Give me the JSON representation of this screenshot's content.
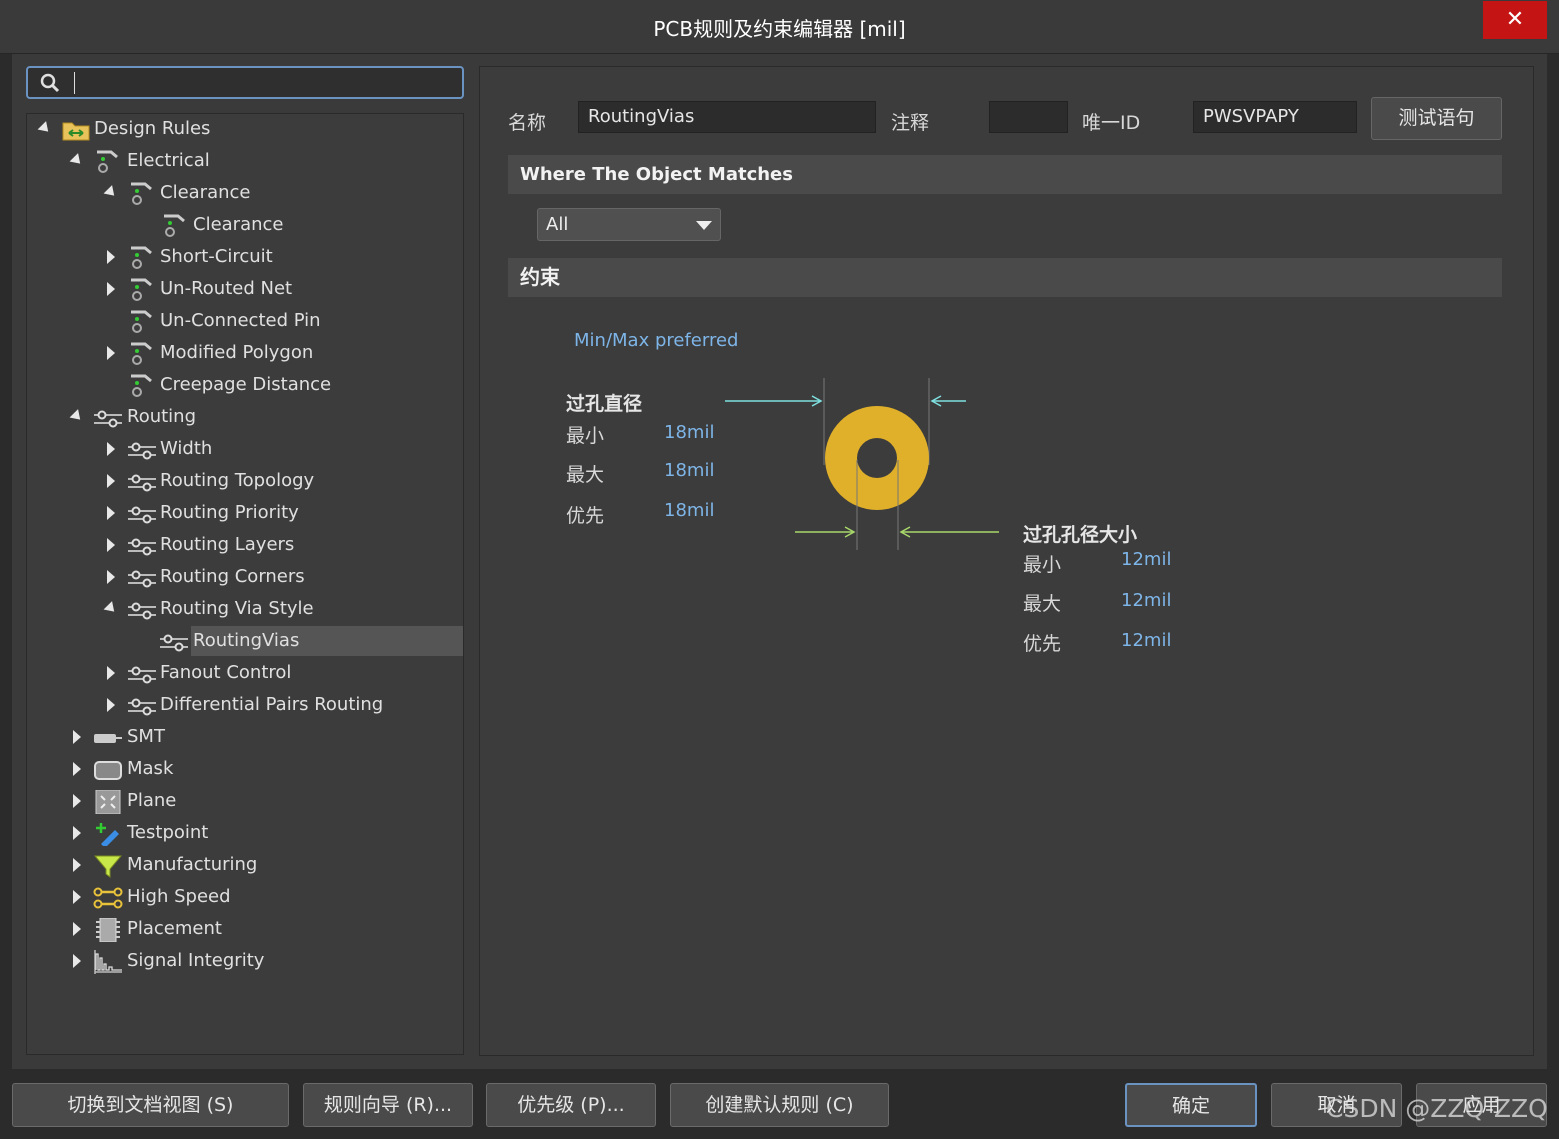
{
  "window": {
    "title": "PCB规则及约束编辑器 [mil]",
    "close_glyph": "✕"
  },
  "search": {
    "value": "",
    "placeholder": ""
  },
  "tree": {
    "root": "Design Rules",
    "electrical": "Electrical",
    "clearance_group": "Clearance",
    "clearance_rule": "Clearance",
    "short_circuit": "Short-Circuit",
    "unrouted_net": "Un-Routed Net",
    "unconnected_pin": "Un-Connected Pin",
    "modified_polygon": "Modified Polygon",
    "creepage_distance": "Creepage Distance",
    "routing": "Routing",
    "width": "Width",
    "routing_topology": "Routing Topology",
    "routing_priority": "Routing Priority",
    "routing_layers": "Routing Layers",
    "routing_corners": "Routing Corners",
    "routing_via_style": "Routing Via Style",
    "routing_vias": "RoutingVias",
    "fanout_control": "Fanout Control",
    "diff_pairs_routing": "Differential Pairs Routing",
    "smt": "SMT",
    "mask": "Mask",
    "plane": "Plane",
    "testpoint": "Testpoint",
    "manufacturing": "Manufacturing",
    "high_speed": "High Speed",
    "placement": "Placement",
    "signal_integrity": "Signal Integrity"
  },
  "rule": {
    "name_label": "名称",
    "name_value": "RoutingVias",
    "comment_label": "注释",
    "comment_value": "",
    "uid_label": "唯一ID",
    "uid_value": "PWSVPAPY",
    "test_button": "测试语句"
  },
  "where_matches": {
    "title": "Where The Object Matches",
    "selected": "All"
  },
  "constraints": {
    "title": "约束",
    "hint": "Min/Max preferred",
    "via_diameter": {
      "title": "过孔直径",
      "min_label": "最小",
      "min_value": "18mil",
      "max_label": "最大",
      "max_value": "18mil",
      "pref_label": "优先",
      "pref_value": "18mil"
    },
    "hole_size": {
      "title": "过孔孔径大小",
      "min_label": "最小",
      "min_value": "12mil",
      "max_label": "最大",
      "max_value": "12mil",
      "pref_label": "优先",
      "pref_value": "12mil"
    },
    "via_color": "#e0b02a",
    "diameter_arrow_color": "#7fe0e0",
    "hole_arrow_color": "#a8d86a"
  },
  "footer": {
    "switch_doc_view": "切换到文档视图 (S)",
    "rule_wizard": "规则向导 (R)...",
    "priority": "优先级 (P)...",
    "create_default": "创建默认规则 (C)",
    "ok": "确定",
    "cancel": "取消",
    "apply": "应用"
  },
  "watermark": "CSDN @ZZQ-ZZQ",
  "colors": {
    "accent": "#6b93c2",
    "close": "#c41414",
    "link": "#7eb5e8"
  }
}
